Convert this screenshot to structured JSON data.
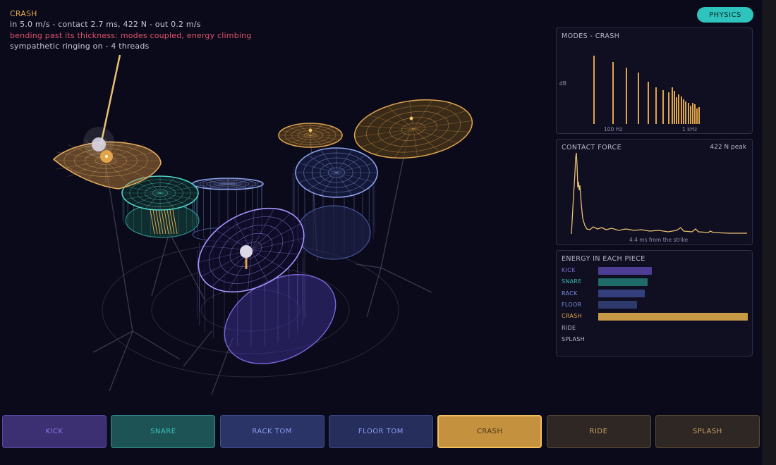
{
  "hud": {
    "title": "CRASH",
    "line1": "in 5.0 m/s  -  contact 2.7 ms, 422 N  -  out 0.2 m/s",
    "warning": "bending past its thickness: modes coupled, energy climbing",
    "line3": "sympathetic ringing on  -  4 threads"
  },
  "physics_button": "PHYSICS",
  "modes": {
    "title": "MODES - CRASH",
    "ylabel": "dB",
    "tick_100": "100 Hz",
    "tick_1k": "1 kHz"
  },
  "contact": {
    "title": "CONTACT FORCE",
    "peak": "422 N peak",
    "caption": "4.4 ms from the strike"
  },
  "energy": {
    "title": "ENERGY IN EACH PIECE",
    "rows": [
      {
        "label": "KICK",
        "value": 0.36,
        "color": "#4e3d95",
        "label_color": "#7e6fd6"
      },
      {
        "label": "SNARE",
        "value": 0.33,
        "color": "#1e6b69",
        "label_color": "#3bbfb5"
      },
      {
        "label": "RACK",
        "value": 0.31,
        "color": "#34407e",
        "label_color": "#7d8fe0"
      },
      {
        "label": "FLOOR",
        "value": 0.26,
        "color": "#2f3a6c",
        "label_color": "#7d8fe0"
      },
      {
        "label": "CRASH",
        "value": 1.0,
        "color": "#c99a45",
        "label_color": "#e0a54a"
      },
      {
        "label": "RIDE",
        "value": 0.0,
        "color": "#c99a45",
        "label_color": "#b9b6c9"
      },
      {
        "label": "SPLASH",
        "value": 0.0,
        "color": "#c99a45",
        "label_color": "#b9b6c9"
      }
    ]
  },
  "pads": [
    {
      "label": "KICK",
      "bg": "#3c2f72",
      "border": "#5b4aa6",
      "color": "#8b7ce6"
    },
    {
      "label": "SNARE",
      "bg": "#1e5356",
      "border": "#2f8d8a",
      "color": "#3bc1b7"
    },
    {
      "label": "RACK TOM",
      "bg": "#2a3466",
      "border": "#3f4d91",
      "color": "#8a9cf0"
    },
    {
      "label": "FLOOR TOM",
      "bg": "#262f5c",
      "border": "#3a4686",
      "color": "#8a9cf0"
    },
    {
      "label": "CRASH",
      "bg": "#c4913f",
      "border": "#f2bf5c",
      "color": "#4a3514"
    },
    {
      "label": "RIDE",
      "bg": "#2e2724",
      "border": "#5a4a38",
      "color": "#c9a35e"
    },
    {
      "label": "SPLASH",
      "bg": "#2e2724",
      "border": "#5a4a38",
      "color": "#c9a35e"
    }
  ]
}
